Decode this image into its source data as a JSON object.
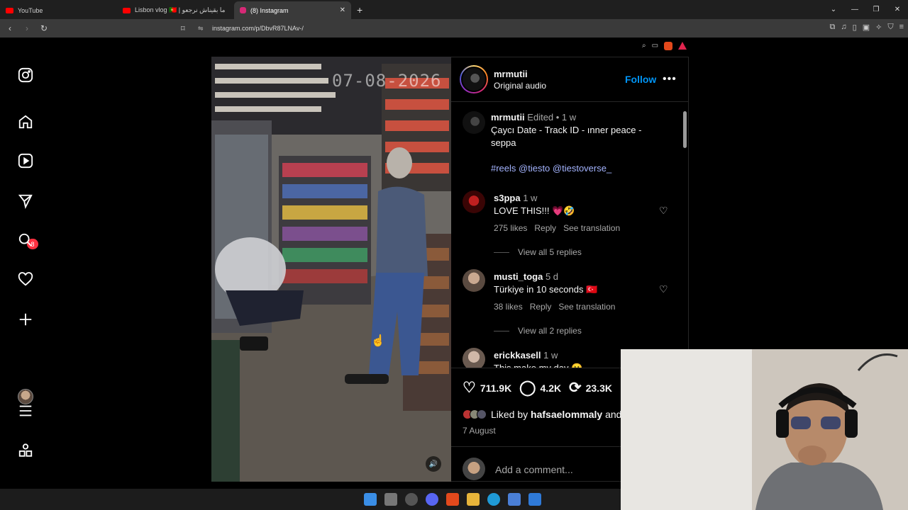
{
  "browser": {
    "tabs": [
      {
        "label": "YouTube",
        "favicon_color": "#ff0000"
      },
      {
        "label": "Lisbon vlog 🇵🇹 | ما بقيناش نرجعو 🤣",
        "favicon_color": "#ff0000"
      },
      {
        "label": "(8) Instagram",
        "favicon_color": "#d62976",
        "active": true
      }
    ],
    "new_tab": "+",
    "url": "instagram.com/p/DbvR87LNAv-/",
    "window_controls": [
      "⌄",
      "—",
      "❐",
      "✕"
    ]
  },
  "sidebar": {
    "items": [
      {
        "name": "instagram-logo-icon",
        "glyph": "◎"
      },
      {
        "name": "home-icon",
        "glyph": "⌂"
      },
      {
        "name": "reels-icon",
        "glyph": "▷"
      },
      {
        "name": "messages-icon",
        "glyph": "✈"
      },
      {
        "name": "search-icon",
        "glyph": "⌕"
      },
      {
        "name": "notifications-icon",
        "glyph": "♡"
      },
      {
        "name": "create-icon",
        "glyph": "+"
      },
      {
        "name": "menu-icon",
        "glyph": "≡"
      },
      {
        "name": "more-apps-icon",
        "glyph": "⊞"
      }
    ],
    "messages_badge": "8"
  },
  "video": {
    "timestamp": "07-08-2026",
    "mute_glyph": "🔊"
  },
  "post": {
    "author": "mrmutii",
    "audio": "Original audio",
    "follow_label": "Follow",
    "more_glyph": "•••",
    "caption": {
      "author": "mrmutii",
      "meta": "Edited • 1 w",
      "text": "Çaycı Date - Track ID - ınner peace - seppa",
      "tags": "#reels @tiesto @tiestoverse_"
    },
    "comments": [
      {
        "user": "s3ppa",
        "time": "1 w",
        "text": "LOVE THIS!!! 💗🤣",
        "likes": "275 likes",
        "reply": "Reply",
        "translate": "See translation",
        "view_replies": "View all 5 replies",
        "avatar_color": "#7a0b0b"
      },
      {
        "user": "musti_toga",
        "time": "5 d",
        "text": "Türkiye in 10 seconds 🇹🇷",
        "likes": "38 likes",
        "reply": "Reply",
        "translate": "See translation",
        "view_replies": "View all 2 replies",
        "avatar_color": "#8c7060"
      },
      {
        "user": "erickkasell",
        "time": "1 w",
        "text": "This make my day 🥲",
        "avatar_color": "#a08878"
      }
    ],
    "stats": {
      "likes": "711.9K",
      "comments": "4.2K",
      "reposts": "23.3K"
    },
    "liked_by_prefix": "Liked by",
    "liked_by_user": "hafsaelommaly",
    "liked_by_suffix": "and",
    "date": "7 August",
    "add_comment_placeholder": "Add a comment..."
  },
  "colors": {
    "follow_blue": "#0095f6",
    "hashtag": "#a4b4ff",
    "badge_red": "#ff3040"
  }
}
